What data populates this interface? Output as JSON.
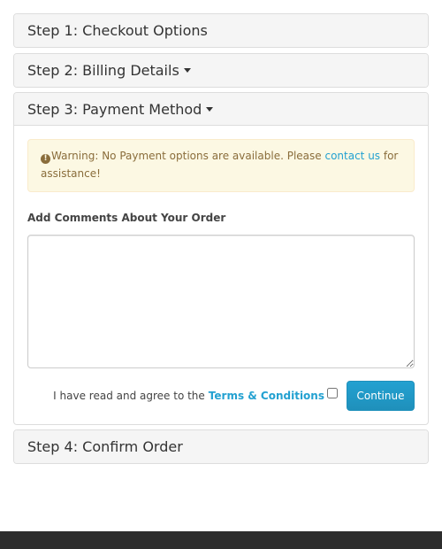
{
  "steps": {
    "step1": {
      "title": "Step 1: Checkout Options"
    },
    "step2": {
      "title": "Step 2: Billing Details"
    },
    "step3": {
      "title": "Step 3: Payment Method",
      "warning": {
        "text_before": "Warning: No Payment options are available. Please ",
        "link": "contact us",
        "text_after": " for assistance!"
      },
      "comments_label": "Add Comments About Your Order",
      "comments_value": "",
      "agree_text": "I have read and agree to the",
      "terms_link": "Terms & Conditions",
      "agree_checked": false,
      "continue_label": "Continue"
    },
    "step4": {
      "title": "Step 4: Confirm Order"
    }
  },
  "colors": {
    "link": "#23a1d1",
    "button": "#229ac8",
    "warning_bg": "#fcf8e3",
    "warning_text": "#8a6d3b",
    "footer": "#2d2d2d"
  },
  "icons": {
    "warning": "exclamation-circle-icon",
    "caret": "caret-down-icon"
  }
}
